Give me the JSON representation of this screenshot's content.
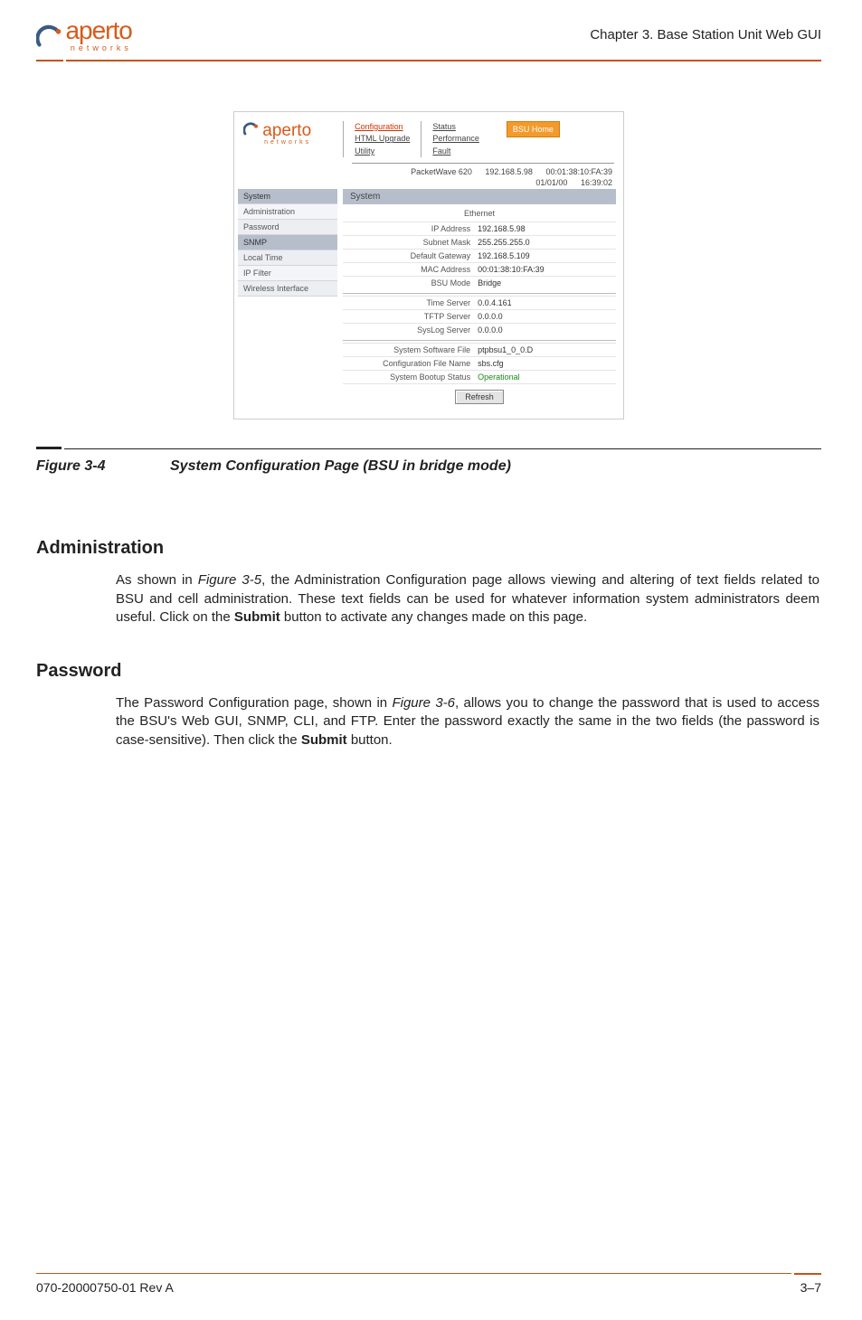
{
  "header": {
    "logo_name": "aperto",
    "logo_sub": "networks",
    "chapter_title": "Chapter 3.  Base Station Unit Web GUI"
  },
  "screenshot": {
    "nav": {
      "col1": {
        "configuration": "Configuration",
        "html_upgrade": "HTML Upgrade",
        "utility": "Utility"
      },
      "col2": {
        "status": "Status",
        "performance": "Performance",
        "fault": "Fault"
      },
      "home_btn": "BSU Home"
    },
    "status_line": {
      "device": "PacketWave 620",
      "ip": "192.168.5.98",
      "mac": "00:01:38:10:FA:39",
      "date": "01/01/00",
      "time": "16:39:02"
    },
    "sidebar": [
      "System",
      "Administration",
      "Password",
      "SNMP",
      "Local Time",
      "IP Filter",
      "Wireless Interface"
    ],
    "section_title": "System",
    "ethernet_label": "Ethernet",
    "rows": [
      {
        "lbl": "IP Address",
        "val": "192.168.5.98"
      },
      {
        "lbl": "Subnet Mask",
        "val": "255.255.255.0"
      },
      {
        "lbl": "Default Gateway",
        "val": "192.168.5.109"
      },
      {
        "lbl": "MAC Address",
        "val": "00:01:38:10:FA:39"
      },
      {
        "lbl": "BSU Mode",
        "val": "Bridge"
      }
    ],
    "rows2": [
      {
        "lbl": "Time Server",
        "val": "0.0.4.161"
      },
      {
        "lbl": "TFTP Server",
        "val": "0.0.0.0"
      },
      {
        "lbl": "SysLog Server",
        "val": "0.0.0.0"
      }
    ],
    "rows3": [
      {
        "lbl": "System Software File",
        "val": "ptpbsu1_0_0.D"
      },
      {
        "lbl": "Configuration File Name",
        "val": "sbs.cfg"
      },
      {
        "lbl": "System Bootup Status",
        "val": "Operational",
        "green": true
      }
    ],
    "refresh_btn": "Refresh"
  },
  "figure": {
    "num": "Figure 3-4",
    "title": "System Configuration Page (BSU in bridge mode)"
  },
  "sections": {
    "admin_heading": "Administration",
    "admin_para_a": "As shown in ",
    "admin_para_fig": "Figure 3-5",
    "admin_para_b": ", the Administration Configuration page allows viewing and altering of text fields related to BSU and cell administration. These text fields can be used for whatever information system administrators deem useful. Click on the ",
    "admin_para_bold": "Submit",
    "admin_para_c": " button to activate any changes made on this page.",
    "pwd_heading": "Password",
    "pwd_para_a": "The Password Configuration page, shown in ",
    "pwd_para_fig": "Figure 3-6",
    "pwd_para_b": ", allows you to change the password that is used to access the BSU's Web GUI, SNMP, CLI, and FTP. Enter the password exactly the same in the two fields (the password is case-sensitive). Then click the ",
    "pwd_para_bold": "Submit",
    "pwd_para_c": " button."
  },
  "footer": {
    "doc_id": "070-20000750-01 Rev A",
    "page_num": "3–7"
  }
}
